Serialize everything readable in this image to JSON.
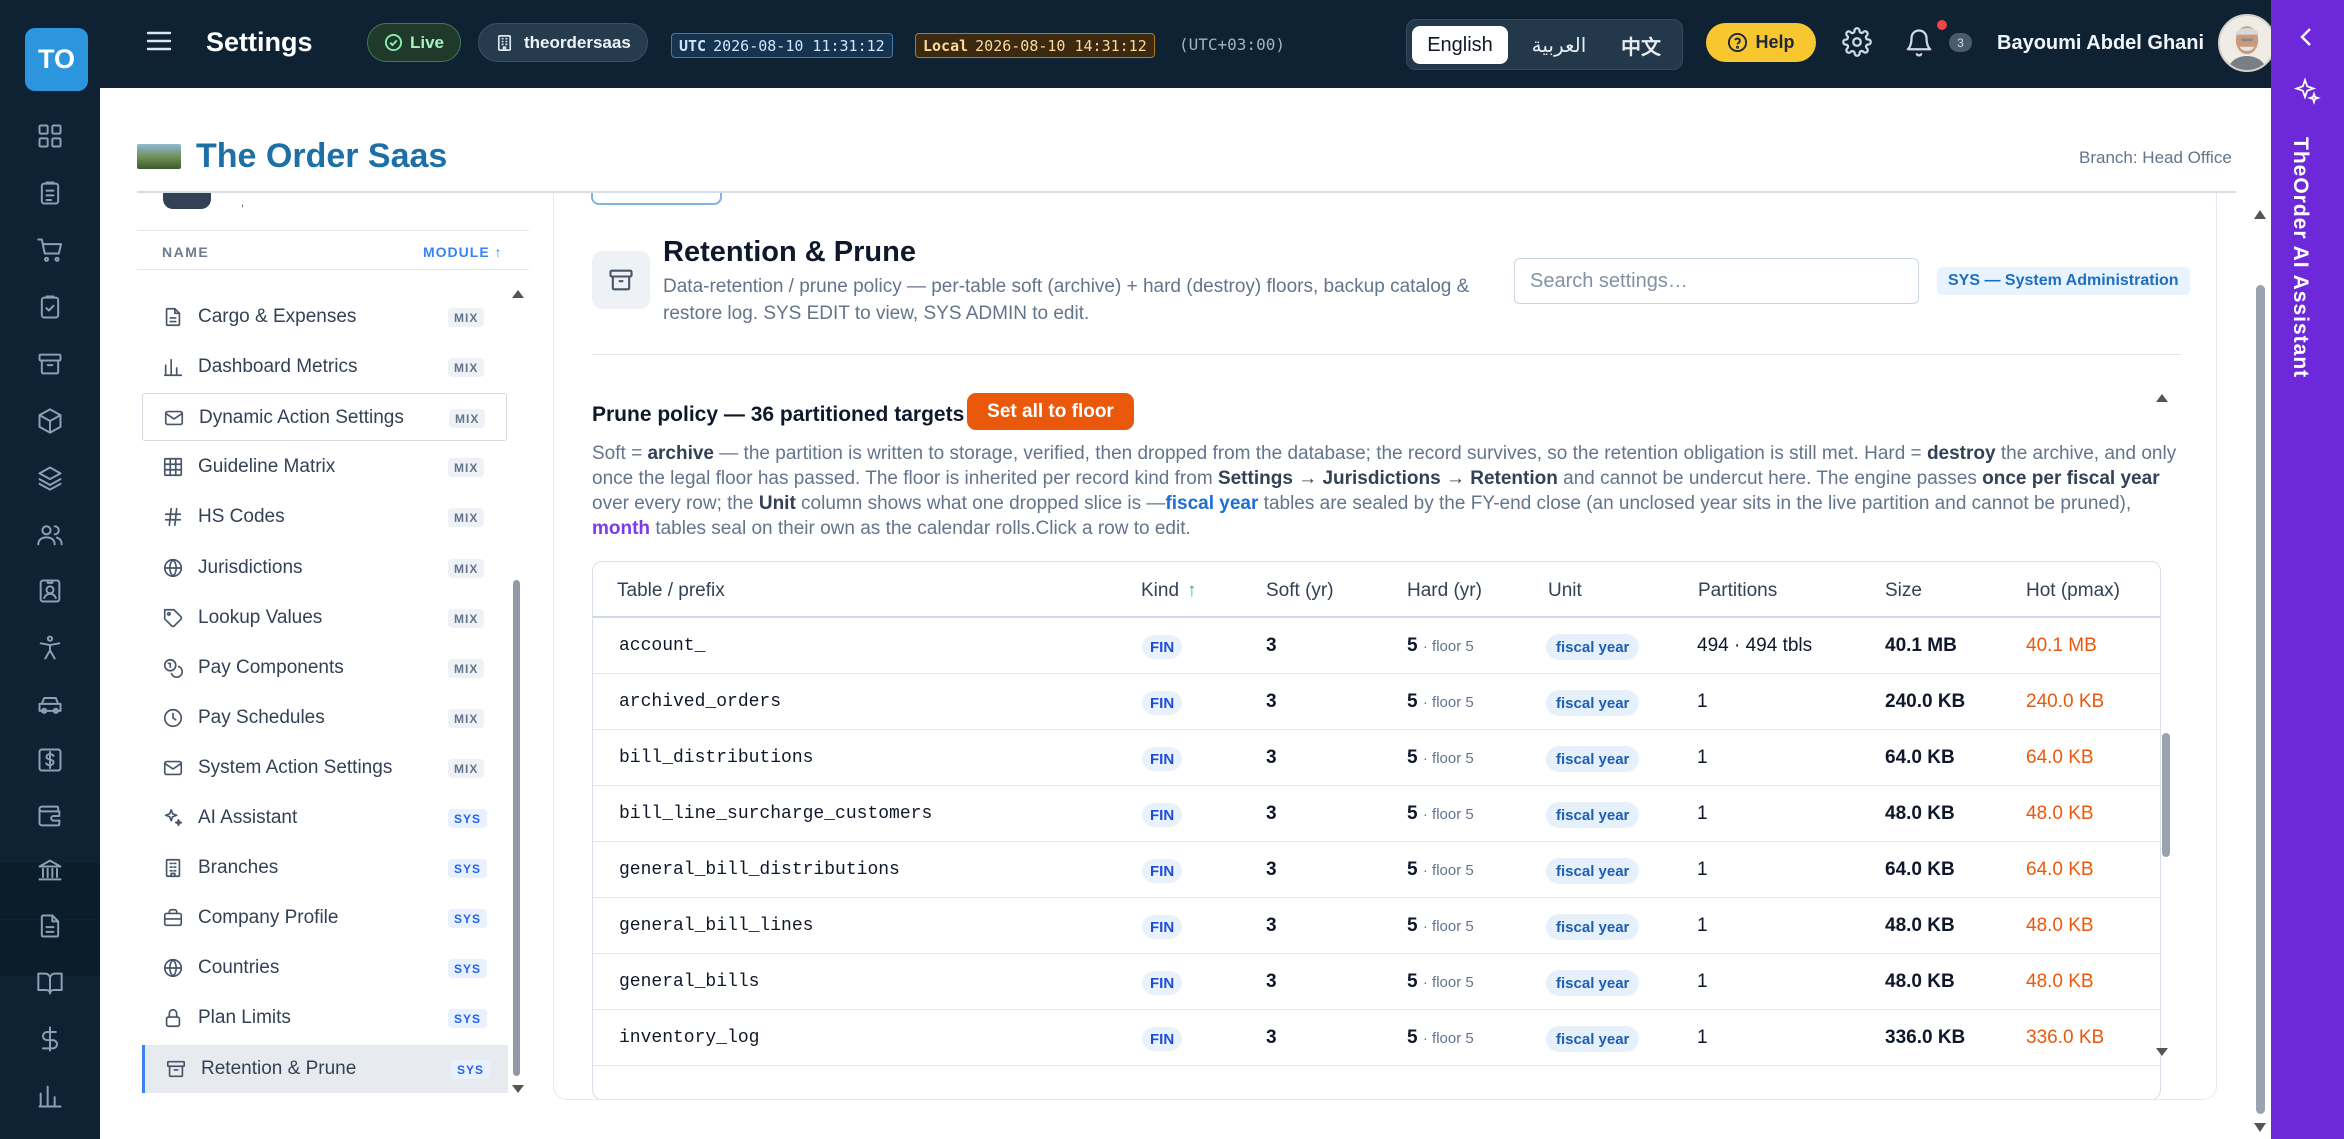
{
  "rail": {
    "logo": "TO",
    "icons": [
      "dashboard-icon",
      "clipboard-list-icon",
      "cart-icon",
      "clipboard-check-icon",
      "archive-icon",
      "box-icon",
      "layers-icon",
      "users-icon",
      "id-card-icon",
      "accessibility-icon",
      "car-icon",
      "dollar-square-icon",
      "wallet-icon",
      "bank-icon",
      "document-icon",
      "book-icon",
      "dollar-icon",
      "bar-chart-icon"
    ]
  },
  "topbar": {
    "title": "Settings",
    "live_label": "Live",
    "tenant": "theordersaas",
    "utc_label": "UTC",
    "utc_time": "2026-08-10 11:31:12",
    "local_label": "Local",
    "local_time": "2026-08-10 14:31:12",
    "offset": "(UTC+03:00)",
    "languages": [
      "English",
      "العربية",
      "中文"
    ],
    "active_language": "English",
    "help_label": "Help",
    "notification_count": "3",
    "user_name": "Bayoumi Abdel Ghani"
  },
  "assistant": {
    "label": "TheOrder AI Assistant",
    "accent": "#6d28d9"
  },
  "org": {
    "name": "The Order Saas",
    "branch": "Branch: Head Office"
  },
  "nav": {
    "col_name": "NAME",
    "col_module": "MODULE ↑",
    "items": [
      {
        "label": "Cargo & Expenses",
        "badge": "MIX",
        "icon": "file-text-icon"
      },
      {
        "label": "Dashboard Metrics",
        "badge": "MIX",
        "icon": "bar-chart-icon"
      },
      {
        "label": "Dynamic Action Settings",
        "badge": "MIX",
        "icon": "mail-icon"
      },
      {
        "label": "Guideline Matrix",
        "badge": "MIX",
        "icon": "grid-icon"
      },
      {
        "label": "HS Codes",
        "badge": "MIX",
        "icon": "hash-icon"
      },
      {
        "label": "Jurisdictions",
        "badge": "MIX",
        "icon": "globe-icon"
      },
      {
        "label": "Lookup Values",
        "badge": "MIX",
        "icon": "tag-icon"
      },
      {
        "label": "Pay Components",
        "badge": "MIX",
        "icon": "coins-icon"
      },
      {
        "label": "Pay Schedules",
        "badge": "MIX",
        "icon": "clock-icon"
      },
      {
        "label": "System Action Settings",
        "badge": "MIX",
        "icon": "mail-icon"
      },
      {
        "label": "AI Assistant",
        "badge": "SYS",
        "icon": "sparkles-icon"
      },
      {
        "label": "Branches",
        "badge": "SYS",
        "icon": "building-icon"
      },
      {
        "label": "Company Profile",
        "badge": "SYS",
        "icon": "briefcase-icon"
      },
      {
        "label": "Countries",
        "badge": "SYS",
        "icon": "globe-icon"
      },
      {
        "label": "Plan Limits",
        "badge": "SYS",
        "icon": "lock-icon"
      },
      {
        "label": "Retention & Prune",
        "badge": "SYS",
        "icon": "archive-icon"
      }
    ],
    "active": "Retention & Prune"
  },
  "module": {
    "title": "Retention & Prune",
    "description": "Data-retention / prune policy — per-table soft (archive) + hard (destroy) floors, backup catalog & restore log. SYS EDIT to view, SYS ADMIN to edit.",
    "search_placeholder": "Search settings…",
    "module_tag": "SYS — System Administration"
  },
  "policy": {
    "title": "Prune policy — 36 partitioned targets",
    "button": "Set all to floor",
    "text": {
      "p1": "Soft = ",
      "b1": "archive",
      "p2": " — the partition is written to storage, verified, then dropped from the database; the record survives, so the retention obligation is still met. Hard = ",
      "b2": "destroy",
      "p3": " the archive, and only once the legal floor has passed. The floor is inherited per record kind from ",
      "b3": "Settings → Jurisdictions → Retention",
      "p4": " and cannot be undercut here. The engine passes ",
      "b4": "once per fiscal year",
      "p5": " over every row; the ",
      "b5": "Unit",
      "p6": " column shows what one dropped slice is —",
      "fy": "fiscal year",
      "p7": " tables are sealed by the FY-end close (an unclosed year sits in the live partition and cannot be pruned), ",
      "mo": "month",
      "p8": " tables seal on their own as the calendar rolls.Click a row to edit."
    }
  },
  "table": {
    "headers": {
      "name": "Table / prefix",
      "kind": "Kind",
      "kind_sort": "↑",
      "soft": "Soft (yr)",
      "hard": "Hard (yr)",
      "unit": "Unit",
      "partitions": "Partitions",
      "size": "Size",
      "hot": "Hot (pmax)"
    },
    "rows": [
      {
        "name": "account_",
        "kind": "FIN",
        "soft": "3",
        "hard": "5",
        "floor": "· floor 5",
        "unit": "fiscal year",
        "partitions": "494 · 494 tbls",
        "size": "40.1 MB",
        "hot": "40.1 MB"
      },
      {
        "name": "archived_orders",
        "kind": "FIN",
        "soft": "3",
        "hard": "5",
        "floor": "· floor 5",
        "unit": "fiscal year",
        "partitions": "1",
        "size": "240.0 KB",
        "hot": "240.0 KB"
      },
      {
        "name": "bill_distributions",
        "kind": "FIN",
        "soft": "3",
        "hard": "5",
        "floor": "· floor 5",
        "unit": "fiscal year",
        "partitions": "1",
        "size": "64.0 KB",
        "hot": "64.0 KB"
      },
      {
        "name": "bill_line_surcharge_customers",
        "kind": "FIN",
        "soft": "3",
        "hard": "5",
        "floor": "· floor 5",
        "unit": "fiscal year",
        "partitions": "1",
        "size": "48.0 KB",
        "hot": "48.0 KB"
      },
      {
        "name": "general_bill_distributions",
        "kind": "FIN",
        "soft": "3",
        "hard": "5",
        "floor": "· floor 5",
        "unit": "fiscal year",
        "partitions": "1",
        "size": "64.0 KB",
        "hot": "64.0 KB"
      },
      {
        "name": "general_bill_lines",
        "kind": "FIN",
        "soft": "3",
        "hard": "5",
        "floor": "· floor 5",
        "unit": "fiscal year",
        "partitions": "1",
        "size": "48.0 KB",
        "hot": "48.0 KB"
      },
      {
        "name": "general_bills",
        "kind": "FIN",
        "soft": "3",
        "hard": "5",
        "floor": "· floor 5",
        "unit": "fiscal year",
        "partitions": "1",
        "size": "48.0 KB",
        "hot": "48.0 KB"
      },
      {
        "name": "inventory_log",
        "kind": "FIN",
        "soft": "3",
        "hard": "5",
        "floor": "· floor 5",
        "unit": "fiscal year",
        "partitions": "1",
        "size": "336.0 KB",
        "hot": "336.0 KB"
      }
    ]
  },
  "colors": {
    "topbar": "#0f2234",
    "brand": "#1d6fa8",
    "accent_orange": "#ea580c",
    "help_yellow": "#f8c62f"
  }
}
